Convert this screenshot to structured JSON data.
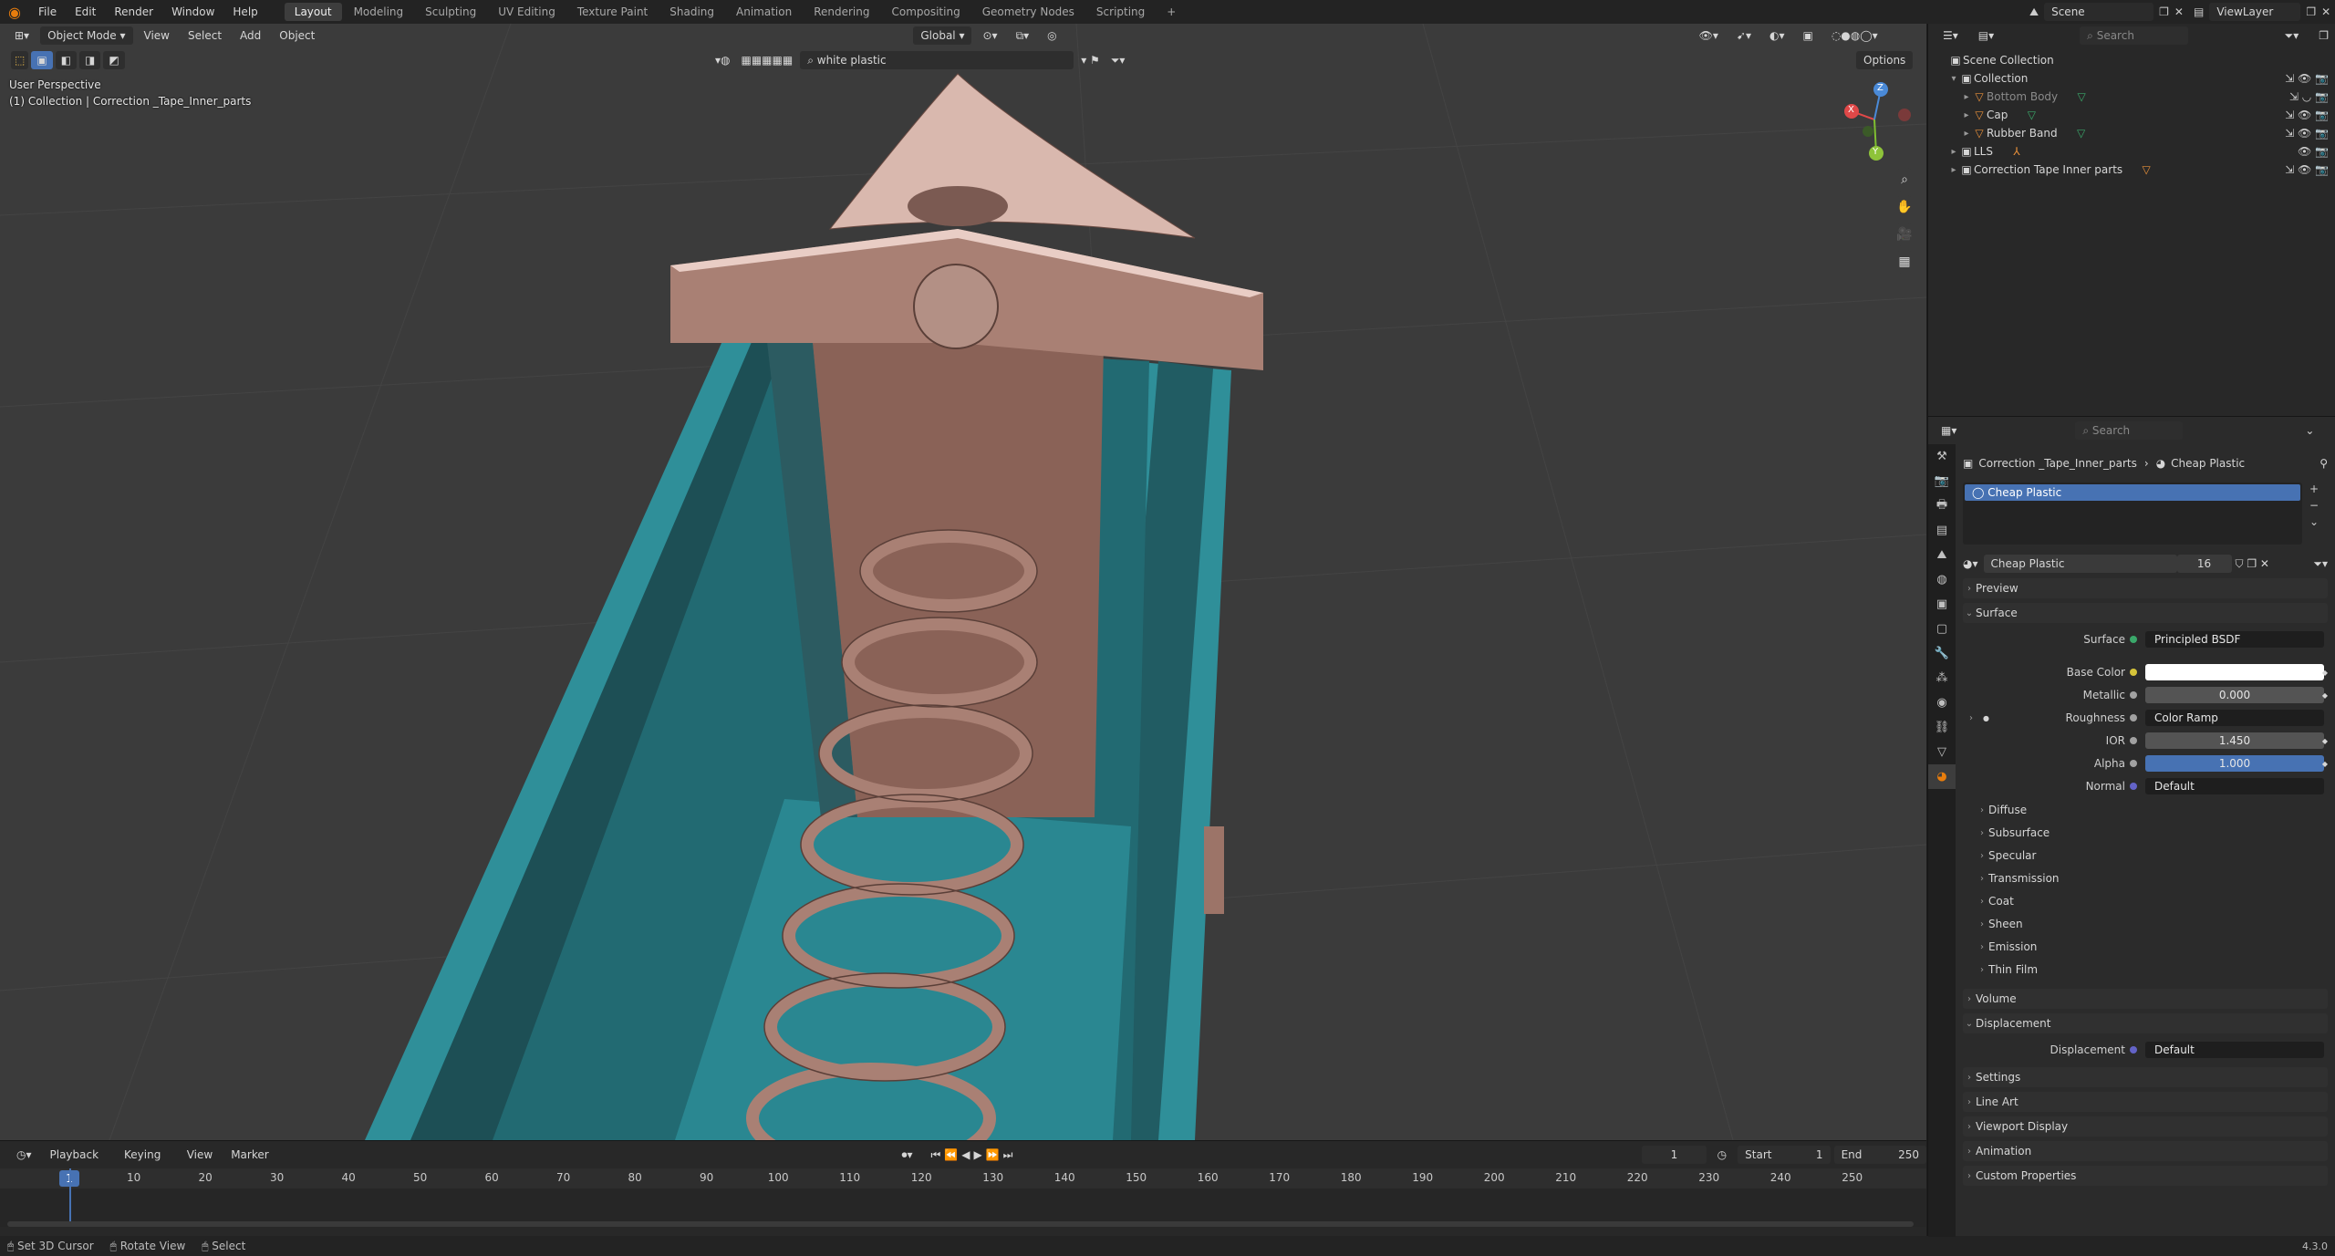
{
  "topbar": {
    "menus": [
      "File",
      "Edit",
      "Render",
      "Window",
      "Help"
    ],
    "workspaces": [
      "Layout",
      "Modeling",
      "Sculpting",
      "UV Editing",
      "Texture Paint",
      "Shading",
      "Animation",
      "Rendering",
      "Compositing",
      "Geometry Nodes",
      "Scripting"
    ],
    "active_workspace": "Layout",
    "add_tab": "+",
    "scene": "Scene",
    "view_layer": "ViewLayer"
  },
  "viewport": {
    "mode": "Object Mode",
    "menus": [
      "View",
      "Select",
      "Add",
      "Object"
    ],
    "transform_orientation": "Global",
    "search_value": "white plastic",
    "options_label": "Options",
    "perspective_label": "User Perspective",
    "collection_label": "(1) Collection | Correction _Tape_Inner_parts",
    "axis_x": "X",
    "axis_y": "Y",
    "axis_z": "Z"
  },
  "outliner": {
    "search_placeholder": "Search",
    "rows": [
      {
        "label": "Scene Collection"
      },
      {
        "label": "Collection"
      },
      {
        "label": "Bottom Body"
      },
      {
        "label": "Cap"
      },
      {
        "label": "Rubber Band"
      },
      {
        "label": "LLS"
      },
      {
        "label": "Correction Tape Inner parts"
      }
    ]
  },
  "properties": {
    "search_placeholder": "Search",
    "breadcrumb_object": "Correction _Tape_Inner_parts",
    "breadcrumb_material": "Cheap Plastic",
    "slot_name": "Cheap Plastic",
    "material_name": "Cheap Plastic",
    "user_count": "16",
    "panels": {
      "preview": "Preview",
      "surface": "Surface",
      "volume": "Volume",
      "displacement": "Displacement",
      "settings": "Settings",
      "line_art": "Line Art",
      "viewport_display": "Viewport Display",
      "animation": "Animation",
      "custom_properties": "Custom Properties"
    },
    "surface_fields": {
      "surface_label": "Surface",
      "surface_value": "Principled BSDF",
      "base_color_label": "Base Color",
      "base_color": "#ffffff",
      "metallic_label": "Metallic",
      "metallic_value": "0.000",
      "roughness_label": "Roughness",
      "roughness_value": "Color Ramp",
      "ior_label": "IOR",
      "ior_value": "1.450",
      "alpha_label": "Alpha",
      "alpha_value": "1.000",
      "normal_label": "Normal",
      "normal_value": "Default"
    },
    "subpanels": [
      "Diffuse",
      "Subsurface",
      "Specular",
      "Transmission",
      "Coat",
      "Sheen",
      "Emission",
      "Thin Film"
    ],
    "displacement_label": "Displacement",
    "displacement_value": "Default"
  },
  "timeline": {
    "menus": [
      "Playback",
      "Keying",
      "View",
      "Marker"
    ],
    "current_frame": "1",
    "start_label": "Start",
    "start_value": "1",
    "end_label": "End",
    "end_value": "250",
    "ticks": [
      "10",
      "20",
      "30",
      "40",
      "50",
      "60",
      "70",
      "80",
      "90",
      "100",
      "110",
      "120",
      "130",
      "140",
      "150",
      "160",
      "170",
      "180",
      "190",
      "200",
      "210",
      "220",
      "230",
      "240",
      "250"
    ],
    "cursor_label": "1"
  },
  "statusbar": {
    "items": [
      "Set 3D Cursor",
      "Rotate View",
      "Select"
    ],
    "version": "4.3.0"
  },
  "colors": {
    "accent": "#4772b3",
    "blender_orange": "#e87d0d",
    "teal": "#2f8f99"
  }
}
